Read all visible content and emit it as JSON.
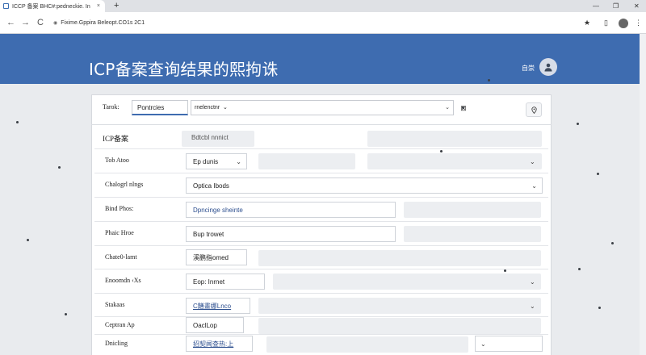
{
  "browser": {
    "tab_title": "ICCP 备案 BHC#:pedneckie. In",
    "tab_close": "×",
    "new_tab": "+",
    "win_minimize": "—",
    "win_restore": "❐",
    "win_close": "✕",
    "back": "←",
    "forward": "→",
    "reload": "C",
    "url": "Fixime.Gppira Beleopt.CO1s 2C1",
    "bookmark_star": "★"
  },
  "header": {
    "title": "ICP备案查询结果的熙拘诛",
    "user_label": "自崇"
  },
  "search": {
    "label": "Tarok:",
    "input_value": "Pontrcies",
    "filter_value": "rnelenctnr",
    "filter_chevron": "⌄",
    "clear_icon": "⊠"
  },
  "section_header": {
    "label": "ICP备案",
    "value": "Bdtcbl nnnict"
  },
  "fields": [
    {
      "label": "Tob Atoo",
      "value": "Ep dunis"
    },
    {
      "label": "Chalogrl nlngs",
      "value": "Optica Ibods"
    },
    {
      "label": "Bind Phos:",
      "value": "Dpncinge sheinte"
    },
    {
      "label": "Phaic Hroe",
      "value": "Bup trowet"
    },
    {
      "label": "Chate0-lamt",
      "value": "溪鹏指omed"
    },
    {
      "label": "Enoomdn ‹Xs",
      "value": "Eop: Inrnet"
    },
    {
      "label": "Stakaas",
      "value": "C饍畫娜Lnco"
    },
    {
      "label": "Ceptran Ap",
      "value": "OaclLop"
    },
    {
      "label": "Dnicling",
      "value": "招契闻查热:上"
    }
  ],
  "colors": {
    "banner": "#3e6cb0",
    "accent": "#3e6cb0",
    "link": "#2d4f8f"
  }
}
